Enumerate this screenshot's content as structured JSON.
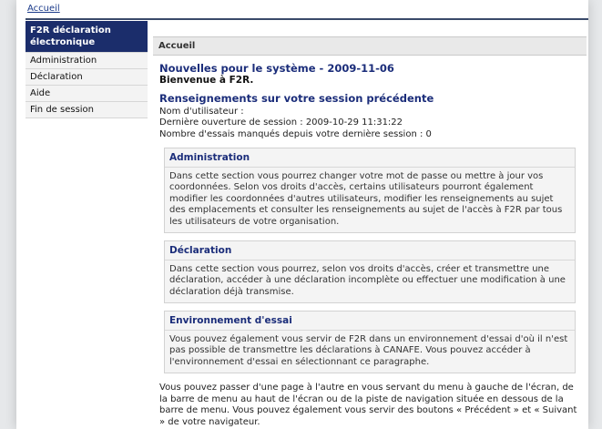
{
  "breadcrumb": "Accueil",
  "sidebar": {
    "items": [
      {
        "label": "F2R déclaration électronique",
        "active": true
      },
      {
        "label": "Administration"
      },
      {
        "label": "Déclaration"
      },
      {
        "label": "Aide"
      },
      {
        "label": "Fin de session"
      }
    ]
  },
  "main": {
    "header": "Accueil",
    "news_title": "Nouvelles pour le système - 2009-11-06",
    "welcome": "Bienvenue à F2R.",
    "session": {
      "title": "Renseignements sur votre session précédente",
      "user_label": "Nom d'utilisateur :",
      "last_open": "Dernière ouverture de session : 2009-10-29 11:31:22",
      "failed": "Nombre d'essais manqués depuis votre dernière session : 0"
    },
    "sections": [
      {
        "title": "Administration",
        "text": "Dans cette section vous pourrez changer votre mot de passe ou mettre à jour vos coordonnées. Selon vos droits d'accès, certains utilisateurs pourront également modifier les coordonnées d'autres utilisateurs, modifier les renseignements au sujet des emplacements et consulter les renseignements au sujet de l'accès à F2R par tous les utilisateurs de votre organisation."
      },
      {
        "title": "Déclaration",
        "text": "Dans cette section vous pourrez, selon vos droits d'accès, créer et transmettre une déclaration, accéder à une déclaration incomplète ou effectuer une modification à une déclaration déjà transmise."
      },
      {
        "title": "Environnement d'essai",
        "text": "Vous pouvez également vous servir de F2R dans un environnement d'essai d'où il n'est pas possible de transmettre les déclarations à CANAFE. Vous pouvez accéder à l'environnement d'essai en sélectionnant ce paragraphe."
      }
    ],
    "bottom_text": "Vous pouvez passer d'une page à l'autre en vous servant du menu à gauche de l'écran, de la barre de menu au haut de l'écran ou de la piste de navigation située en dessous de la barre de menu. Vous pouvez également vous servir des boutons « Précédent » et « Suivant » de votre navigateur."
  },
  "colors": {
    "nav_active_bg": "#1b2d6b",
    "heading_blue": "#1b2d7a"
  }
}
